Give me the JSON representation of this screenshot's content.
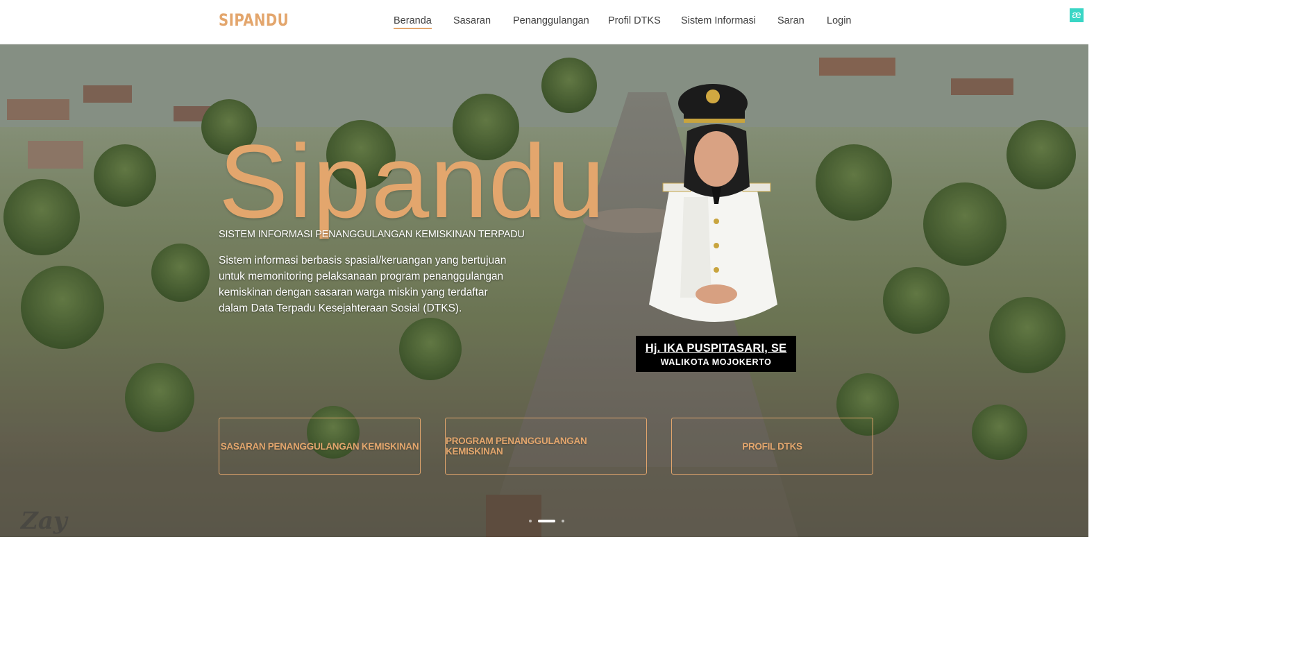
{
  "navbar": {
    "logo": "SIPANDU",
    "items": [
      {
        "label": "Beranda",
        "active": true
      },
      {
        "label": "Sasaran"
      },
      {
        "label": "Penanggulangan"
      },
      {
        "label": "Profil DTKS"
      },
      {
        "label": "Sistem Informasi"
      },
      {
        "label": "Saran"
      },
      {
        "label": "Login"
      }
    ],
    "extension_icon": "æ"
  },
  "hero": {
    "title": "Sipandu",
    "subtitle": "SISTEM INFORMASI PENANGGULANGAN KEMISKINAN TERPADU",
    "description": "Sistem informasi berbasis spasial/keruangan yang bertujuan untuk memonitoring pelaksanaan program penanggulangan kemiskinan dengan sasaran warga miskin yang terdaftar dalam Data Terpadu Kesejahteraan Sosial (DTKS).",
    "official": {
      "name": "Hj. IKA PUSPITASARI, SE",
      "role": "WALIKOTA MOJOKERTO"
    },
    "buttons": [
      {
        "label": "SASARAN PENANGGULANGAN KEMISKINAN"
      },
      {
        "label": "PROGRAM PENANGGULANGAN KEMISKINAN"
      },
      {
        "label": "PROFIL DTKS"
      }
    ],
    "slider": {
      "count": 3,
      "active_index": 1
    },
    "watermark": "Zay"
  },
  "colors": {
    "accent": "#e3a66d",
    "nav_text": "#3e3e3e",
    "caption_bg": "#000000",
    "extension_icon_bg": "#39d6c5"
  }
}
